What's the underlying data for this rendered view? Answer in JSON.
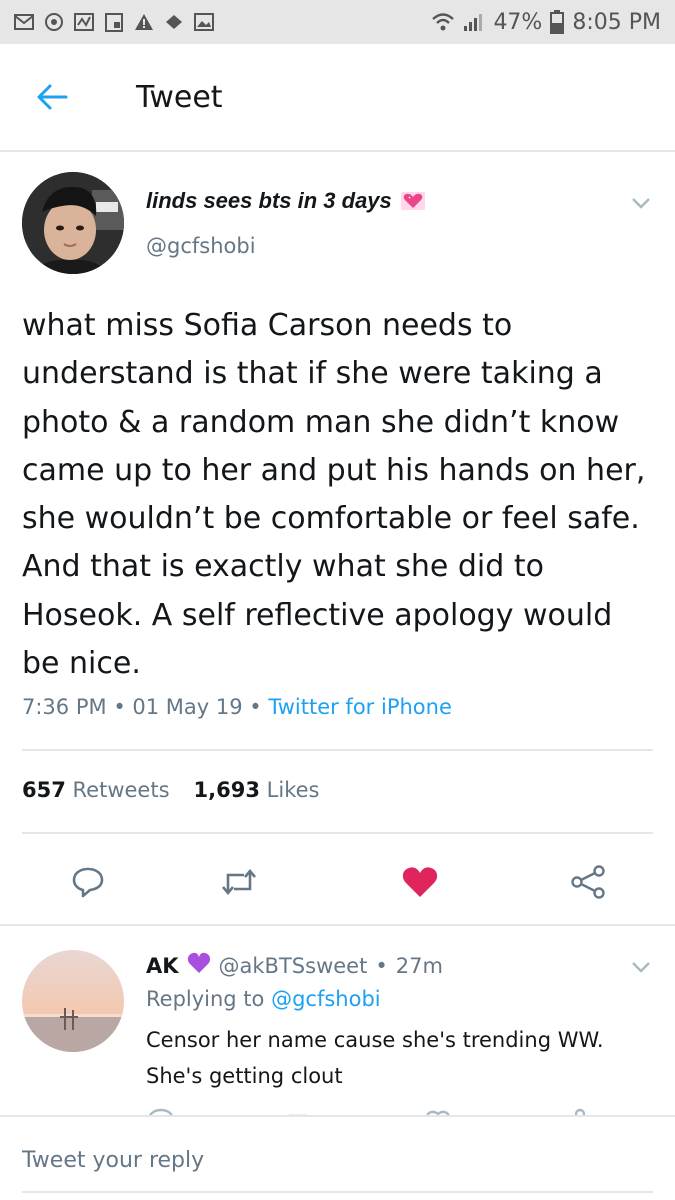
{
  "status_bar": {
    "battery": "47%",
    "time": "8:05 PM",
    "icons": [
      "mail-icon",
      "sync-icon",
      "gallery-icon",
      "clipboard-icon",
      "warning-icon",
      "shield-icon",
      "image-icon",
      "wifi-icon",
      "signal-icon",
      "battery-icon"
    ]
  },
  "header": {
    "title": "Tweet",
    "back_icon": "arrow-left-icon"
  },
  "tweet": {
    "display_name": "linds sees bts in 3 days",
    "name_emoji": "sparkling-heart",
    "handle": "@gcfshobi",
    "text": "what miss Sofia Carson needs to understand is that if she were taking a photo & a random man she didn’t know came up to her and put his hands on her, she wouldn’t be comfortable or feel safe. And that is exactly what she did to Hoseok. A self reflective apology would be nice.",
    "time": "7:36 PM",
    "date": "01 May 19",
    "separator": "•",
    "source": "Twitter for iPhone",
    "retweets_count": "657",
    "retweets_label": "Retweets",
    "likes_count": "1,693",
    "likes_label": "Likes",
    "liked": true,
    "colors": {
      "accent": "#1da1f2",
      "like": "#e0245e",
      "muted": "#657786"
    }
  },
  "reply": {
    "name": "AK",
    "name_emoji": "purple-heart",
    "handle": "@akBTSsweet",
    "separator": "•",
    "time_ago": "27m",
    "replying_prefix": "Replying to",
    "replying_to": "@gcfshobi",
    "text": "Censor her name cause she's trending WW. She's getting clout"
  },
  "composer": {
    "placeholder": "Tweet your reply"
  }
}
